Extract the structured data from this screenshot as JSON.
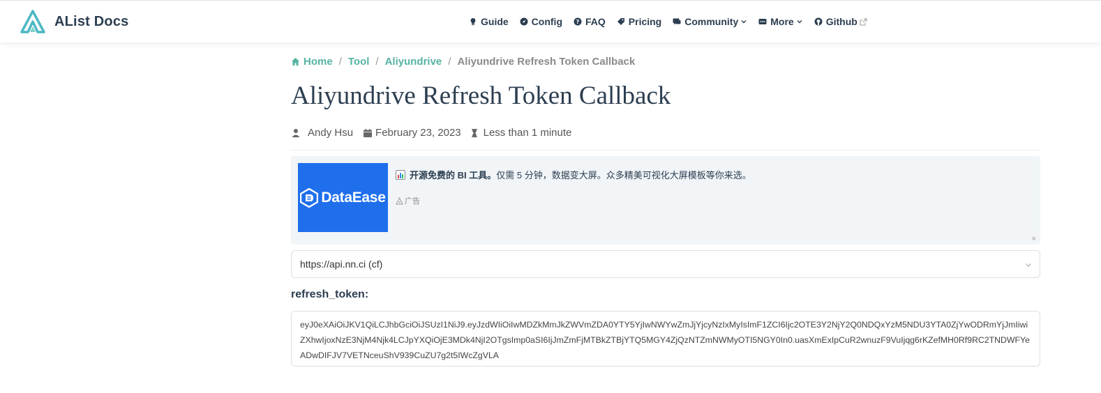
{
  "brand": {
    "title": "AList Docs"
  },
  "nav": {
    "items": [
      {
        "label": "Guide",
        "icon": "lightbulb-icon"
      },
      {
        "label": "Config",
        "icon": "compass-icon"
      },
      {
        "label": "FAQ",
        "icon": "question-circle-icon"
      },
      {
        "label": "Pricing",
        "icon": "tag-icon"
      },
      {
        "label": "Community",
        "icon": "comments-icon",
        "dropdown": true
      },
      {
        "label": "More",
        "icon": "more-icon",
        "dropdown": true
      },
      {
        "label": "Github",
        "icon": "github-icon",
        "external": true
      }
    ]
  },
  "breadcrumb": {
    "home": "Home",
    "tool": "Tool",
    "aliyundrive": "Aliyundrive",
    "current": "Aliyundrive Refresh Token Callback"
  },
  "page": {
    "title": "Aliyundrive Refresh Token Callback",
    "author": "Andy Hsu",
    "date": "February 23, 2023",
    "reading_time": "Less than 1 minute"
  },
  "ad": {
    "logo_text": "DataEase",
    "headline_bold": "开源免费的 BI 工具。",
    "headline_rest": "仅需 5 分钟，数据变大屏。众多精美可视化大屏模板等你来选。",
    "tag": "广告",
    "close": "×"
  },
  "form": {
    "api_select_value": "https://api.nn.ci (cf)",
    "refresh_token_label": "refresh_token:",
    "refresh_token_value": "eyJ0eXAiOiJKV1QiLCJhbGciOiJSUzI1NiJ9.eyJzdWIiOiIwMDZkMmJkZWVmZDA0YTY5YjIwNWYwZmJjYjcyNzIxMyIsImF1ZCI6Ijc2OTE3Y2NjY2Q0NDQxYzM5NDU3YTA0ZjYwODRmYjJmIiwiZXhwIjoxNzE3NjM4Njk4LCJpYXQiOjE3MDk4NjI2OTgsImp0aSI6IjJmZmFjMTBkZTBjYTQ5MGY4ZjQzNTZmNWMyOTI5NGY0In0.uasXmExIpCuR2wnuzF9VuIjqg6rKZefMH0Rf9RC2TNDWFYeADwDIFJV7VETNceuShV939CuZU7g2t5IWcZgVLA"
  },
  "colors": {
    "accent": "#3eaf7c",
    "link": "#56b3a3",
    "ad_blue": "#1f6fed",
    "ad_bg": "#f1f5f8"
  }
}
